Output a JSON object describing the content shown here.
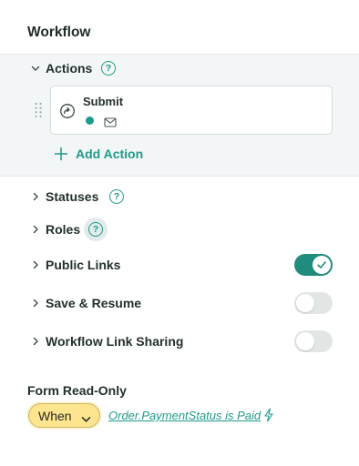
{
  "header": {
    "title": "Workflow"
  },
  "actions": {
    "label": "Actions",
    "help": "?",
    "items": [
      {
        "title": "Submit",
        "icon": "arrow-circle-icon",
        "status_color": "#1e9b8a",
        "channel_icon": "mail-icon"
      }
    ],
    "add_label": "Add Action"
  },
  "sections": [
    {
      "label": "Statuses",
      "help": "?"
    },
    {
      "label": "Roles",
      "help": "?"
    },
    {
      "label": "Public Links",
      "enabled": true
    },
    {
      "label": "Save & Resume",
      "enabled": false
    },
    {
      "label": "Workflow Link Sharing",
      "enabled": false
    }
  ],
  "read_only": {
    "label": "Form Read-Only",
    "when_label": "When",
    "condition": "Order.PaymentStatus is Paid"
  },
  "colors": {
    "accent": "#1e9b8a",
    "toggle_on": "#1f8c7d",
    "when_bg": "#fde48f"
  }
}
